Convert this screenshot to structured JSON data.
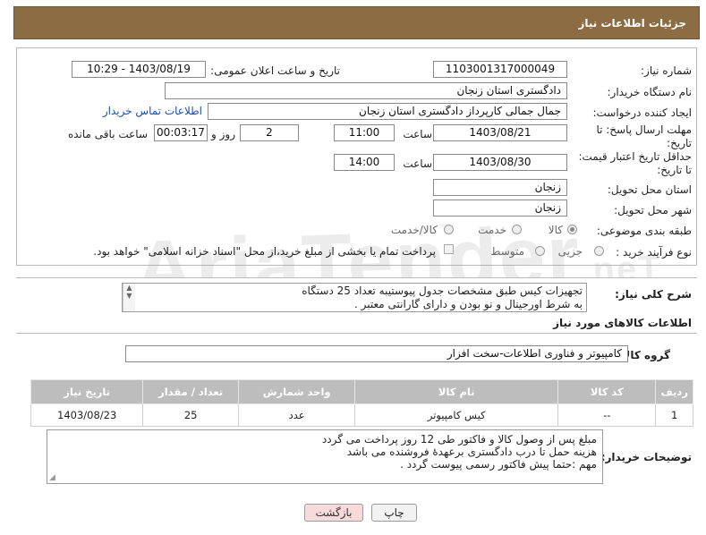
{
  "header": {
    "title": "جزئیات اطلاعات نیاز"
  },
  "form": {
    "need_number_label": "شماره نیاز:",
    "need_number": "1103001317000049",
    "announce_label": "تاریخ و ساعت اعلان عمومی:",
    "announce_value": "1403/08/19 - 10:29",
    "buyer_org_label": "نام دستگاه خریدار:",
    "buyer_org": "دادگستری استان زنجان",
    "creator_label": "ایجاد کننده درخواست:",
    "creator": "جمال جمالی کارپرداز دادگستری استان زنجان",
    "contact_link": "اطلاعات تماس خریدار",
    "deadline_label": "مهلت ارسال پاسخ: تا تاریخ:",
    "deadline_date": "1403/08/21",
    "time_label": "ساعت",
    "deadline_time": "11:00",
    "days_value": "2",
    "days_label": "روز و",
    "remaining_value": "00:03:17",
    "remaining_label": "ساعت باقی مانده",
    "price_valid_label": "حداقل تاریخ اعتبار قیمت: تا تاریخ:",
    "price_valid_date": "1403/08/30",
    "price_valid_time": "14:00",
    "province_label": "استان محل تحویل:",
    "province": "زنجان",
    "city_label": "شهر محل تحویل:",
    "city": "زنجان",
    "category_label": "طبقه بندی موضوعی:",
    "category_options": [
      "کالا",
      "خدمت",
      "کالا/خدمت"
    ],
    "purchase_type_label": "نوع فرآیند خرید :",
    "purchase_options": [
      "جزیی",
      "متوسط"
    ],
    "payment_note": "پرداخت تمام یا بخشی از مبلغ خرید،از محل \"اسناد خزانه اسلامی\" خواهد بود."
  },
  "summary": {
    "label": "شرح کلی نیاز:",
    "line1": "تجهیزات کیس طبق مشخصات جدول پیوستیبه تعداد 25 دستگاه",
    "line2": "به شرط اورجینال و نو بودن و دارای گارانتی معتبر ."
  },
  "goods": {
    "section_title": "اطلاعات کالاهای مورد نیاز",
    "group_label": "گروه کالا:",
    "group_value": "کامپیوتر و فناوری اطلاعات-سخت افزار",
    "headers": [
      "ردیف",
      "کد کالا",
      "نام کالا",
      "واحد شمارش",
      "تعداد / مقدار",
      "تاریخ نیاز"
    ],
    "rows": [
      {
        "row": "1",
        "code": "--",
        "name": "کیس کامپیوتر",
        "unit": "عدد",
        "qty": "25",
        "date": "1403/08/23"
      }
    ]
  },
  "buyer_notes": {
    "label": "توضیحات خریدار:",
    "line1": "مبلغ پس از وصول کالا و فاکتور طی 12 روز پرداخت می گردد",
    "line2": "هزینه حمل تا درب دادگستری برعهدۀ فروشنده می باشد",
    "line3": "مهم :حتما پیش فاکتور رسمی پیوست گردد ."
  },
  "buttons": {
    "print": "چاپ",
    "back": "بازگشت"
  },
  "watermark": "AriaTender.net",
  "colors": {
    "header_bg": "#8c6d43",
    "table_header": "#bdbdbd",
    "link": "#1a4fb0",
    "back_btn_bg": "#f7dada"
  }
}
